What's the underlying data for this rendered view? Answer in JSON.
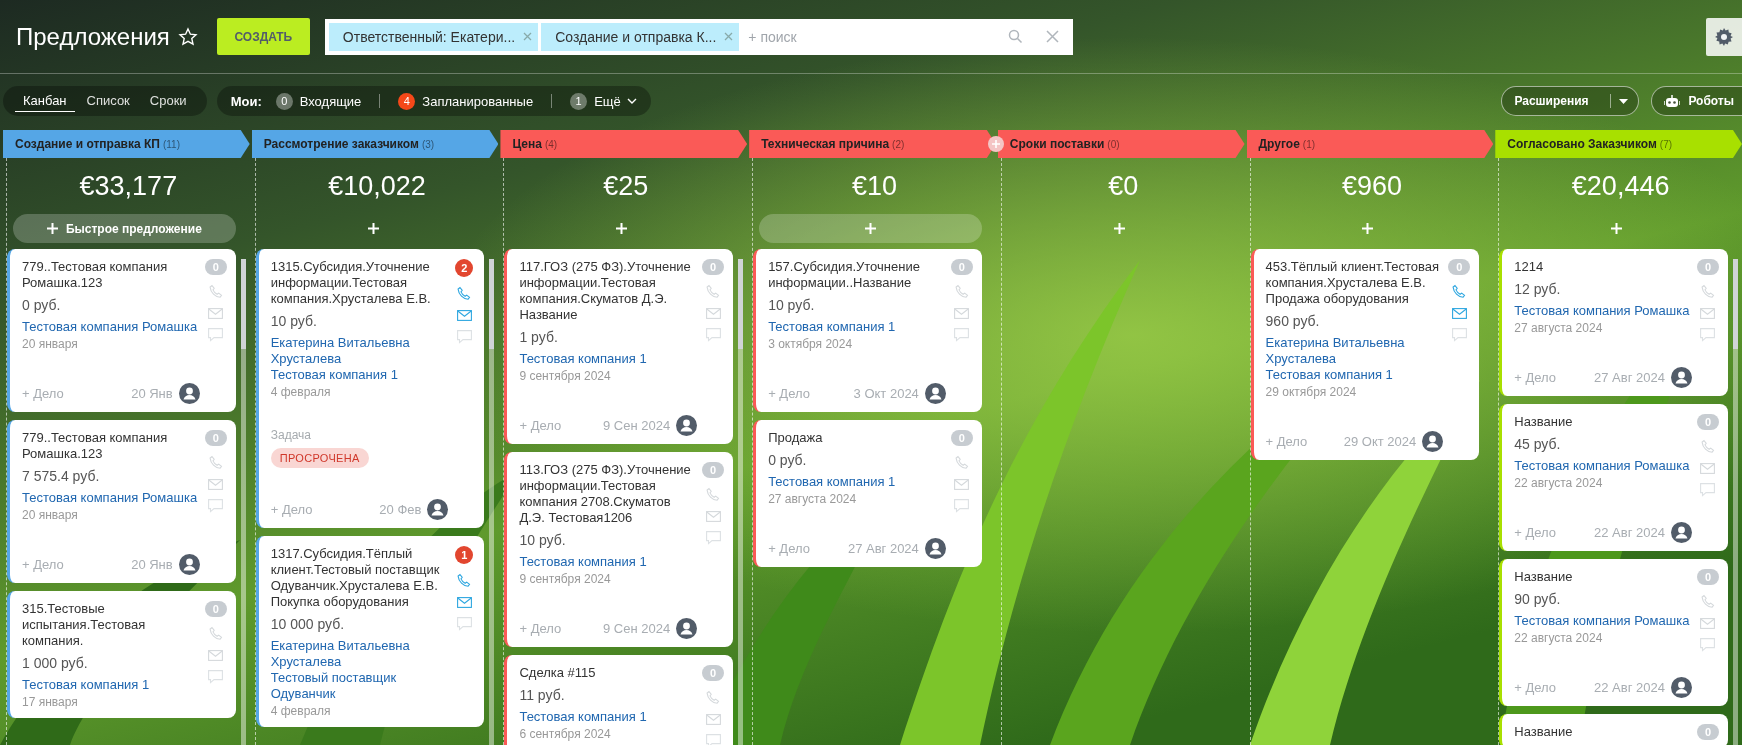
{
  "header": {
    "title": "Предложения",
    "create_button": "СОЗДАТЬ",
    "filter": {
      "chips": [
        "Ответственный: Екатери...",
        "Создание и отправка К..."
      ],
      "placeholder": "+ поиск"
    }
  },
  "views": [
    {
      "label": "Канбан",
      "selected": true
    },
    {
      "label": "Список",
      "selected": false
    },
    {
      "label": "Сроки",
      "selected": false
    }
  ],
  "my_counters": {
    "label": "Мои:",
    "items": [
      {
        "count": "0",
        "label": "Входящие",
        "alert": false,
        "kind": "link"
      },
      {
        "count": "4",
        "label": "Запланированные",
        "alert": true,
        "kind": "link"
      },
      {
        "count": "1",
        "label": "Ещё",
        "alert": false,
        "kind": "menu"
      }
    ]
  },
  "toolbar_right": {
    "extensions": "Расширения",
    "robots": "Роботы"
  },
  "columns": [
    {
      "title": "Создание и отправка КП",
      "count": "(11)",
      "color": "#55a6e6",
      "sum": "€33,177",
      "quick_add": {
        "label": "Быстрое предложение",
        "highlighted": true
      },
      "scrollbar": true,
      "cards": [
        {
          "title": "779..Тестовая компания Ромашка.123",
          "price": "0 руб.",
          "links": [
            "Тестовая компания Ромашка"
          ],
          "date": "20 января",
          "counter": "0",
          "counter_alert": false,
          "phone_active": false,
          "mail_active": false,
          "add_activity": "+ Дело",
          "date_short": "20 Янв"
        },
        {
          "title": "779..Тестовая компания Ромашка.123",
          "price": "7 575.4 руб.",
          "links": [
            "Тестовая компания Ромашка"
          ],
          "date": "20 января",
          "counter": "0",
          "counter_alert": false,
          "phone_active": false,
          "mail_active": false,
          "add_activity": "+ Дело",
          "date_short": "20 Янв"
        },
        {
          "title": "315.Тестовые испытания.Тестовая компания.",
          "price": "1 000 руб.",
          "links": [
            "Тестовая компания 1"
          ],
          "date": "17 января",
          "counter": "0",
          "counter_alert": false,
          "phone_active": false,
          "mail_active": false
        }
      ]
    },
    {
      "title": "Рассмотрение заказчиком",
      "count": "(3)",
      "color": "#55a6e6",
      "sum": "€10,022",
      "quick_add": {
        "highlighted": false
      },
      "scrollbar": true,
      "cards": [
        {
          "title": "1315.Субсидия.Уточнение информации.Тестовая компания.Хрусталева Е.В.",
          "price": "10 руб.",
          "links": [
            "Екатерина Витальевна Хрусталева",
            "Тестовая компания 1"
          ],
          "date": "4 февраля",
          "task": {
            "label": "Задача",
            "status": "ПРОСРОЧЕНА"
          },
          "counter": "2",
          "counter_alert": true,
          "phone_active": true,
          "mail_active": true,
          "add_activity": "+ Дело",
          "date_short": "20 Фев"
        },
        {
          "title": "1317.Субсидия.Тёплый клиент.Тестовый поставщик Одуванчик.Хрусталева Е.В. Покупка оборудования",
          "price": "10 000 руб.",
          "links": [
            "Екатерина Витальевна Хрусталева",
            "Тестовый поставщик Одуванчик"
          ],
          "date": "4 февраля",
          "counter": "1",
          "counter_alert": true,
          "phone_active": true,
          "mail_active": true
        }
      ]
    },
    {
      "title": "Цена",
      "count": "(4)",
      "color": "#fa5a57",
      "sum": "€25",
      "quick_add": {
        "highlighted": false
      },
      "scrollbar": true,
      "cards": [
        {
          "title": "117.ГОЗ (275 ФЗ).Уточнение информации.Тестовая компания.Скуматов Д.Э. Название",
          "price": "1 руб.",
          "links": [
            "Тестовая компания 1"
          ],
          "date": "9 сентября 2024",
          "counter": "0",
          "counter_alert": false,
          "phone_active": false,
          "mail_active": false,
          "add_activity": "+ Дело",
          "date_short": "9 Сен 2024"
        },
        {
          "title": "113.ГОЗ (275 ФЗ).Уточнение информации.Тестовая компания 2708.Скуматов Д.Э. Тестовая1206",
          "price": "10 руб.",
          "links": [
            "Тестовая компания 1"
          ],
          "date": "9 сентября 2024",
          "counter": "0",
          "counter_alert": false,
          "phone_active": false,
          "mail_active": false,
          "add_activity": "+ Дело",
          "date_short": "9 Сен 2024"
        },
        {
          "title": "Сделка #115",
          "price": "11 руб.",
          "links": [
            "Тестовая компания 1"
          ],
          "date": "6 сентября 2024",
          "counter": "0",
          "counter_alert": false,
          "phone_active": false,
          "mail_active": false
        }
      ]
    },
    {
      "title": "Техническая причина",
      "count": "(2)",
      "color": "#fa5a57",
      "sum": "€10",
      "quick_add": {
        "highlighted": true
      },
      "add_stage": true,
      "cards": [
        {
          "title": "157.Субсидия.Уточнение информации..Название",
          "price": "10 руб.",
          "links": [
            "Тестовая компания 1"
          ],
          "date": "3 октября 2024",
          "counter": "0",
          "counter_alert": false,
          "phone_active": false,
          "mail_active": false,
          "add_activity": "+ Дело",
          "date_short": "3 Окт 2024"
        },
        {
          "title": "Продажа",
          "price": "0 руб.",
          "links": [
            "Тестовая компания 1"
          ],
          "date": "27 августа 2024",
          "counter": "0",
          "counter_alert": false,
          "phone_active": false,
          "mail_active": false,
          "add_activity": "+ Дело",
          "date_short": "27 Авг 2024"
        }
      ]
    },
    {
      "title": "Сроки поставки",
      "count": "(0)",
      "color": "#fa5a57",
      "sum": "€0",
      "quick_add": {
        "highlighted": false
      }
    },
    {
      "title": "Другое",
      "count": "(1)",
      "color": "#fa5a57",
      "sum": "€960",
      "quick_add": {
        "highlighted": false
      },
      "cards": [
        {
          "title": "453.Тёплый клиент.Тестовая компания.Хрусталева Е.В. Продажа оборудования",
          "price": "960 руб.",
          "links": [
            "Екатерина Витальевна Хрусталева",
            "Тестовая компания 1"
          ],
          "date": "29 октября 2024",
          "counter": "0",
          "counter_alert": false,
          "phone_active": true,
          "mail_active": true,
          "add_activity": "+ Дело",
          "date_short": "29 Окт 2024"
        }
      ]
    },
    {
      "title": "Согласовано Заказчиком",
      "count": "(7)",
      "color": "#a8e000",
      "sum": "€20,446",
      "quick_add": {
        "highlighted": false
      },
      "scrollbar": true,
      "cards": [
        {
          "title": "1214",
          "price": "12 руб.",
          "links": [
            "Тестовая компания Ромашка"
          ],
          "date": "27 августа 2024",
          "counter": "0",
          "counter_alert": false,
          "phone_active": false,
          "mail_active": false,
          "add_activity": "+ Дело",
          "date_short": "27 Авг 2024"
        },
        {
          "title": "Название",
          "price": "45 руб.",
          "links": [
            "Тестовая компания Ромашка"
          ],
          "date": "22 августа 2024",
          "counter": "0",
          "counter_alert": false,
          "phone_active": false,
          "mail_active": false,
          "add_activity": "+ Дело",
          "date_short": "22 Авг 2024"
        },
        {
          "title": "Название",
          "price": "90 руб.",
          "links": [
            "Тестовая компания Ромашка"
          ],
          "date": "22 августа 2024",
          "counter": "0",
          "counter_alert": false,
          "phone_active": false,
          "mail_active": false,
          "add_activity": "+ Дело",
          "date_short": "22 Авг 2024"
        },
        {
          "title": "Название",
          "counter": "0",
          "counter_alert": false
        }
      ]
    }
  ]
}
